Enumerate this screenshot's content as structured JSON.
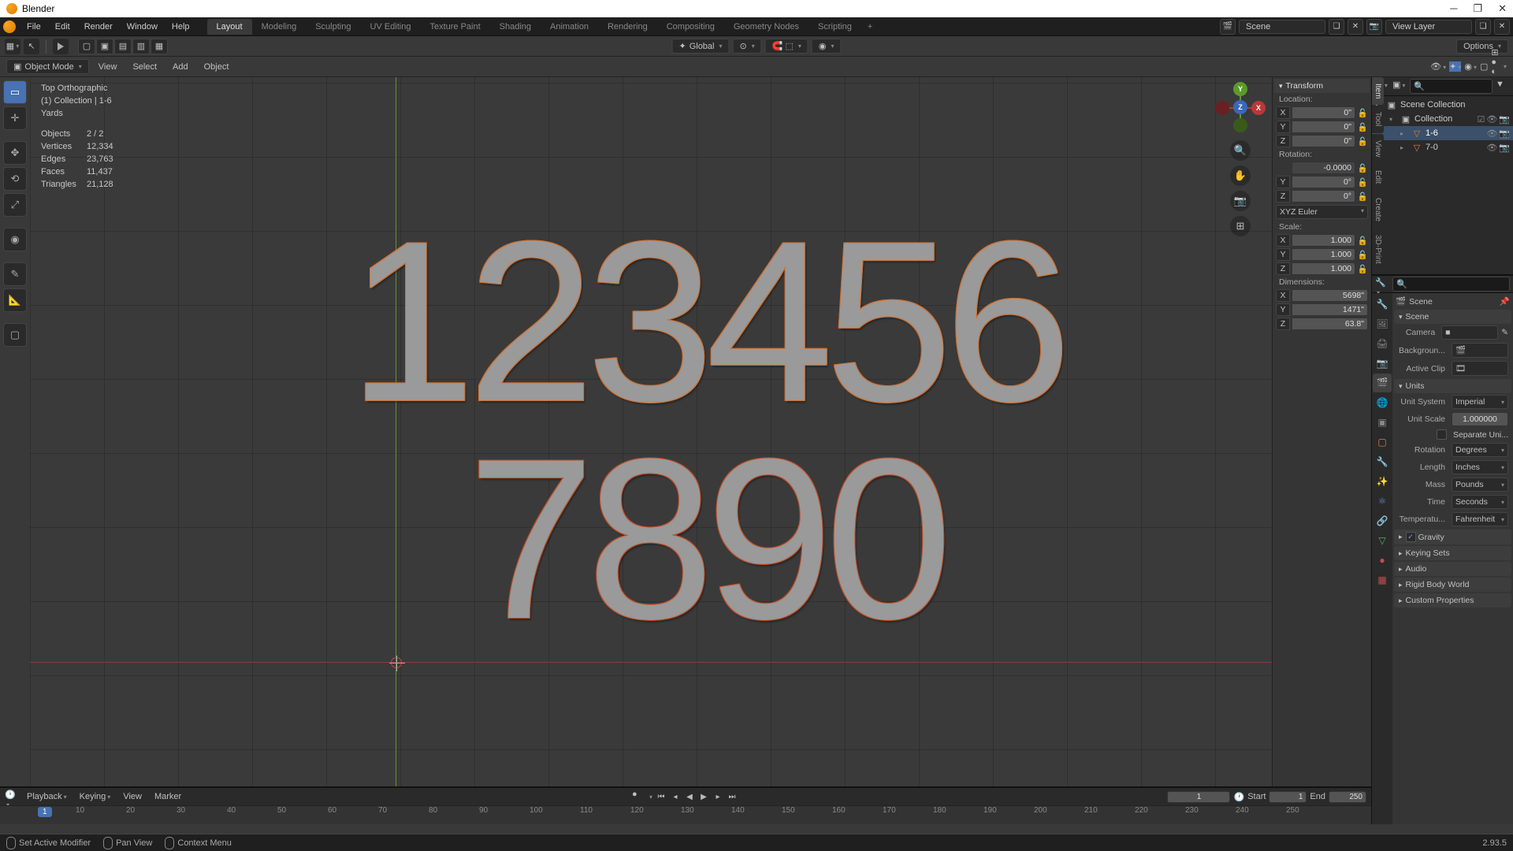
{
  "title": "Blender",
  "version": "2.93.5",
  "menubar": [
    "File",
    "Edit",
    "Render",
    "Window",
    "Help"
  ],
  "workspaces": [
    "Layout",
    "Modeling",
    "Sculpting",
    "UV Editing",
    "Texture Paint",
    "Shading",
    "Animation",
    "Rendering",
    "Compositing",
    "Geometry Nodes",
    "Scripting"
  ],
  "active_workspace": "Layout",
  "scene_field": "Scene",
  "viewlayer_field": "View Layer",
  "tool_header": {
    "orientation": "Global",
    "options": "Options"
  },
  "second_header": {
    "mode": "Object Mode",
    "menus": [
      "View",
      "Select",
      "Add",
      "Object"
    ]
  },
  "viewport_overlay": {
    "title": "Top Orthographic",
    "subtitle": "(1) Collection | 1-6",
    "unit": "Yards",
    "stats": [
      [
        "Objects",
        "2 / 2"
      ],
      [
        "Vertices",
        "12,334"
      ],
      [
        "Edges",
        "23,763"
      ],
      [
        "Faces",
        "11,437"
      ],
      [
        "Triangles",
        "21,128"
      ]
    ]
  },
  "numerals_line1": "123456",
  "numerals_line2": "7890",
  "n_panel": {
    "header": "Transform",
    "location_label": "Location:",
    "rotation_label": "Rotation:",
    "scale_label": "Scale:",
    "dimensions_label": "Dimensions:",
    "loc": {
      "x": "0\"",
      "y": "0\"",
      "z": "0\""
    },
    "rot": {
      "x": "-0.0000",
      "y": "0°",
      "z": "0°"
    },
    "rot_mode": "XYZ Euler",
    "scale": {
      "x": "1.000",
      "y": "1.000",
      "z": "1.000"
    },
    "dim": {
      "x": "5698\"",
      "y": "1471\"",
      "z": "63.8\""
    },
    "vtabs": [
      "Item",
      "Tool",
      "View",
      "Edit",
      "Create",
      "3D-Print"
    ]
  },
  "outliner": {
    "root": "Scene Collection",
    "collection": "Collection",
    "items": [
      {
        "name": "1-6",
        "sel": true
      },
      {
        "name": "7-0",
        "sel": false
      }
    ]
  },
  "properties": {
    "breadcrumb": "Scene",
    "scene_panel": "Scene",
    "camera_label": "Camera",
    "background_label": "Backgroun...",
    "activeclip_label": "Active Clip",
    "units_panel": "Units",
    "unit_system_label": "Unit System",
    "unit_system": "Imperial",
    "unit_scale_label": "Unit Scale",
    "unit_scale": "1.000000",
    "separate_label": "Separate Uni...",
    "rotation_label": "Rotation",
    "rotation": "Degrees",
    "length_label": "Length",
    "length": "Inches",
    "mass_label": "Mass",
    "mass": "Pounds",
    "time_label": "Time",
    "time": "Seconds",
    "temperature_label": "Temperatu...",
    "temperature": "Fahrenheit",
    "other_panels": [
      "Gravity",
      "Keying Sets",
      "Audio",
      "Rigid Body World",
      "Custom Properties"
    ]
  },
  "timeline": {
    "menus": [
      "Playback",
      "Keying",
      "View",
      "Marker"
    ],
    "current": "1",
    "start_label": "Start",
    "start": "1",
    "end_label": "End",
    "end": "250",
    "ticks": [
      "10",
      "20",
      "30",
      "40",
      "50",
      "60",
      "70",
      "80",
      "90",
      "100",
      "110",
      "120",
      "130",
      "140",
      "150",
      "160",
      "170",
      "180",
      "190",
      "200",
      "210",
      "220",
      "230",
      "240",
      "250"
    ]
  },
  "statusbar": {
    "left": "Set Active Modifier",
    "mid": "Pan View",
    "right": "Context Menu"
  }
}
